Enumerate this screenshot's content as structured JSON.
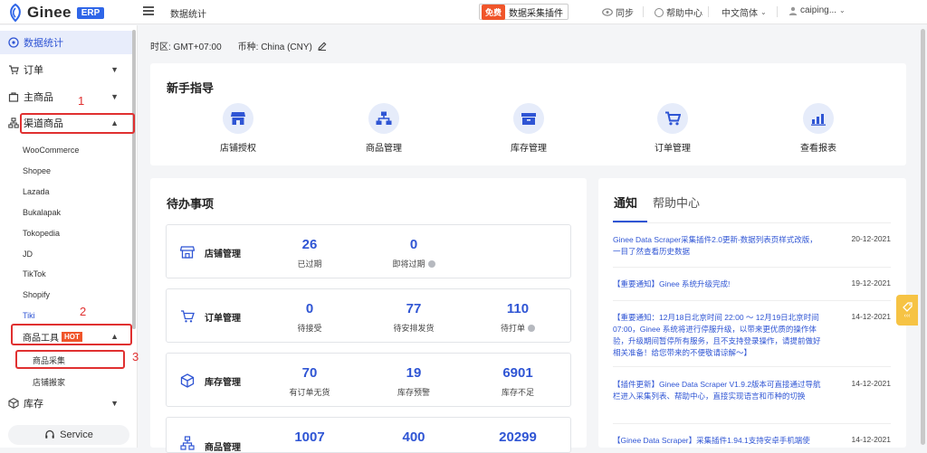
{
  "header": {
    "brand": "Ginee",
    "badge": "ERP",
    "page_title": "数据统计",
    "plugin_free": "免费",
    "plugin_label": "数据采集插件",
    "sync": "同步",
    "help": "帮助中心",
    "language": "中文简体",
    "user": "caiping..."
  },
  "sidebar": {
    "dashboard": "数据统计",
    "orders": "订单",
    "master_products": "主商品",
    "channel_products": "渠道商品",
    "channels": [
      "WooCommerce",
      "Shopee",
      "Lazada",
      "Bukalapak",
      "Tokopedia",
      "JD",
      "TikTok",
      "Shopify",
      "Tiki"
    ],
    "product_tools": "商品工具",
    "hot": "HOT",
    "product_collect": "商品采集",
    "store_move": "店铺搬家",
    "inventory": "库存",
    "service": "Service"
  },
  "annotations": {
    "a1": "1",
    "a2": "2",
    "a3": "3"
  },
  "toolbar": {
    "timezone": "时区: GMT+07:00",
    "currency": "币种: China (CNY)"
  },
  "guide": {
    "title": "新手指导",
    "items": [
      "店铺授权",
      "商品管理",
      "库存管理",
      "订单管理",
      "查看报表"
    ]
  },
  "todo": {
    "title": "待办事项",
    "groups": [
      {
        "name": "店铺管理",
        "stats": [
          {
            "value": "26",
            "label": "已过期"
          },
          {
            "value": "0",
            "label": "即将过期"
          }
        ]
      },
      {
        "name": "订单管理",
        "stats": [
          {
            "value": "0",
            "label": "待接受"
          },
          {
            "value": "77",
            "label": "待安排发货"
          },
          {
            "value": "110",
            "label": "待打单"
          }
        ]
      },
      {
        "name": "库存管理",
        "stats": [
          {
            "value": "70",
            "label": "有订单无货"
          },
          {
            "value": "19",
            "label": "库存预警"
          },
          {
            "value": "6901",
            "label": "库存不足"
          }
        ]
      },
      {
        "name": "商品管理",
        "stats": [
          {
            "value": "1007",
            "label": ""
          },
          {
            "value": "400",
            "label": ""
          },
          {
            "value": "20299",
            "label": ""
          }
        ]
      }
    ]
  },
  "notices": {
    "tab_notice": "通知",
    "tab_help": "帮助中心",
    "items": [
      {
        "text": "Ginee Data Scraper采集插件2.0更新-数据列表页样式改版，一目了然查看历史数据",
        "date": "20-12-2021"
      },
      {
        "text": "【重要通知】Ginee 系统升级完成!",
        "date": "19-12-2021"
      },
      {
        "text": "【重要通知：12月18日北京时间 22:00 ～ 12月19日北京时间 07:00，Ginee 系统将进行停服升级，以带来更优质的操作体验，升级期间暂停所有服务，且不支持登录操作，请提前做好相关准备！给您带来的不便敬请谅解～】",
        "date": "14-12-2021"
      },
      {
        "text": "【插件更新】Ginee Data Scraper V1.9.2版本可直接通过导航栏进入采集列表、帮助中心，直接实现语言和币种的切换",
        "date": "14-12-2021"
      },
      {
        "text": "【Ginee Data Scraper】采集插件1.94.1支持安卓手机端使",
        "date": "14-12-2021"
      }
    ]
  },
  "colors": {
    "primary": "#2f55d4",
    "annotation": "#e03030",
    "hot": "#f0552a",
    "float": "#f6c344"
  }
}
